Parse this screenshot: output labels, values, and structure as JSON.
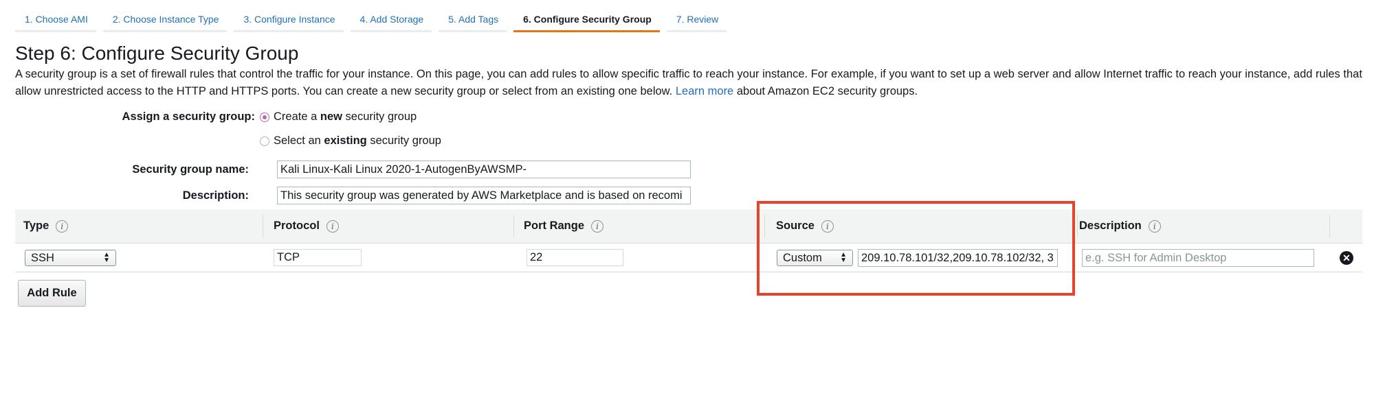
{
  "tabs": [
    {
      "label": "1. Choose AMI"
    },
    {
      "label": "2. Choose Instance Type"
    },
    {
      "label": "3. Configure Instance"
    },
    {
      "label": "4. Add Storage"
    },
    {
      "label": "5. Add Tags"
    },
    {
      "label": "6. Configure Security Group",
      "active": true
    },
    {
      "label": "7. Review"
    }
  ],
  "page": {
    "title": "Step 6: Configure Security Group",
    "intro_text": "A security group is a set of firewall rules that control the traffic for your instance. On this page, you can add rules to allow specific traffic to reach your instance. For example, if you want to set up a web server and allow Internet traffic to reach your instance, add rules that allow unrestricted access to the HTTP and HTTPS ports. You can create a new security group or select from an existing one below.",
    "learn_more": "Learn more",
    "intro_suffix": "about Amazon EC2 security groups."
  },
  "form": {
    "assign_label": "Assign a security group:",
    "option_new": {
      "prefix": "Create a ",
      "bold": "new",
      "suffix": " security group",
      "selected": true
    },
    "option_existing": {
      "prefix": "Select an ",
      "bold": "existing",
      "suffix": " security group",
      "selected": false
    },
    "name_label": "Security group name:",
    "name_value": "Kali Linux-Kali Linux 2020-1-AutogenByAWSMP-",
    "description_label": "Description:",
    "description_value": "This security group was generated by AWS Marketplace and is based on recomi"
  },
  "table": {
    "headers": [
      "Type",
      "Protocol",
      "Port Range",
      "Source",
      "Description"
    ],
    "info_glyph": "i",
    "rows": [
      {
        "type": "SSH",
        "protocol": "TCP",
        "port_range": "22",
        "source_type": "Custom",
        "source_value": "209.10.78.101/32,209.10.78.102/32, 3",
        "description_placeholder": "e.g. SSH for Admin Desktop"
      }
    ]
  },
  "buttons": {
    "add_rule": "Add Rule",
    "remove_glyph": "✕"
  },
  "icons": {
    "info": "info-icon",
    "remove": "remove-circle-icon",
    "select_arrows": "select-arrows-icon"
  },
  "colors": {
    "link": "#1f6fb5",
    "active_tab_underline": "#ec7211",
    "radio_selected": "#b16bb4",
    "highlight_box": "#e8412c",
    "header_bg": "#f2f3f3"
  }
}
